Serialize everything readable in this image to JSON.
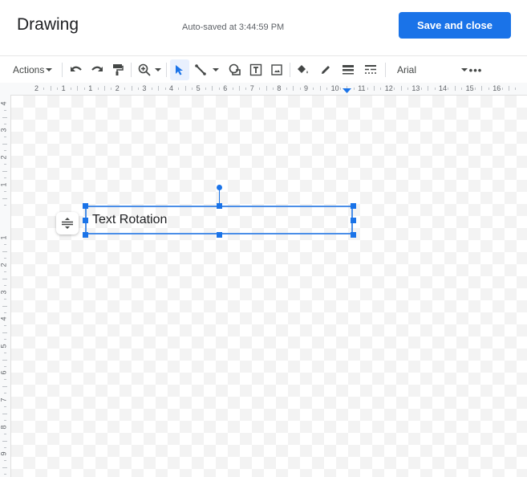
{
  "header": {
    "title": "Drawing",
    "autosave_status": "Auto-saved at 3:44:59 PM",
    "save_button_label": "Save and close"
  },
  "toolbar": {
    "actions_label": "Actions",
    "items": [
      {
        "name": "undo",
        "icon": "undo-icon"
      },
      {
        "name": "redo",
        "icon": "redo-icon"
      },
      {
        "name": "paint-format",
        "icon": "paint-roller-icon"
      },
      {
        "name": "zoom",
        "icon": "zoom-in-icon",
        "has_dropdown": true
      },
      {
        "name": "select",
        "icon": "cursor-arrow-icon",
        "selected": true
      },
      {
        "name": "line",
        "icon": "line-icon",
        "has_dropdown": true
      },
      {
        "name": "shape",
        "icon": "shape-icon"
      },
      {
        "name": "text-box",
        "icon": "text-box-icon"
      },
      {
        "name": "image",
        "icon": "image-icon"
      },
      {
        "name": "fill-color",
        "icon": "paint-bucket-icon"
      },
      {
        "name": "border-color",
        "icon": "pencil-icon"
      },
      {
        "name": "border-weight",
        "icon": "line-weight-icon"
      },
      {
        "name": "border-dash",
        "icon": "line-dash-icon"
      },
      {
        "name": "more",
        "icon": "more-horizontal-icon"
      }
    ],
    "font": "Arial"
  },
  "ruler": {
    "horizontal_labels": [
      "2",
      "1",
      "1",
      "2",
      "3",
      "4",
      "5",
      "6",
      "7",
      "8",
      "9",
      "10",
      "11",
      "12",
      "13",
      "14",
      "15",
      "16"
    ],
    "vertical_labels": [
      "4",
      "3",
      "2",
      "1",
      "1",
      "2",
      "3",
      "4",
      "5",
      "6",
      "7",
      "8",
      "9"
    ]
  },
  "canvas": {
    "text_box": {
      "text": "Text Rotation"
    }
  },
  "colors": {
    "accent": "#1a73e8",
    "selection": "#4a8ee8"
  }
}
